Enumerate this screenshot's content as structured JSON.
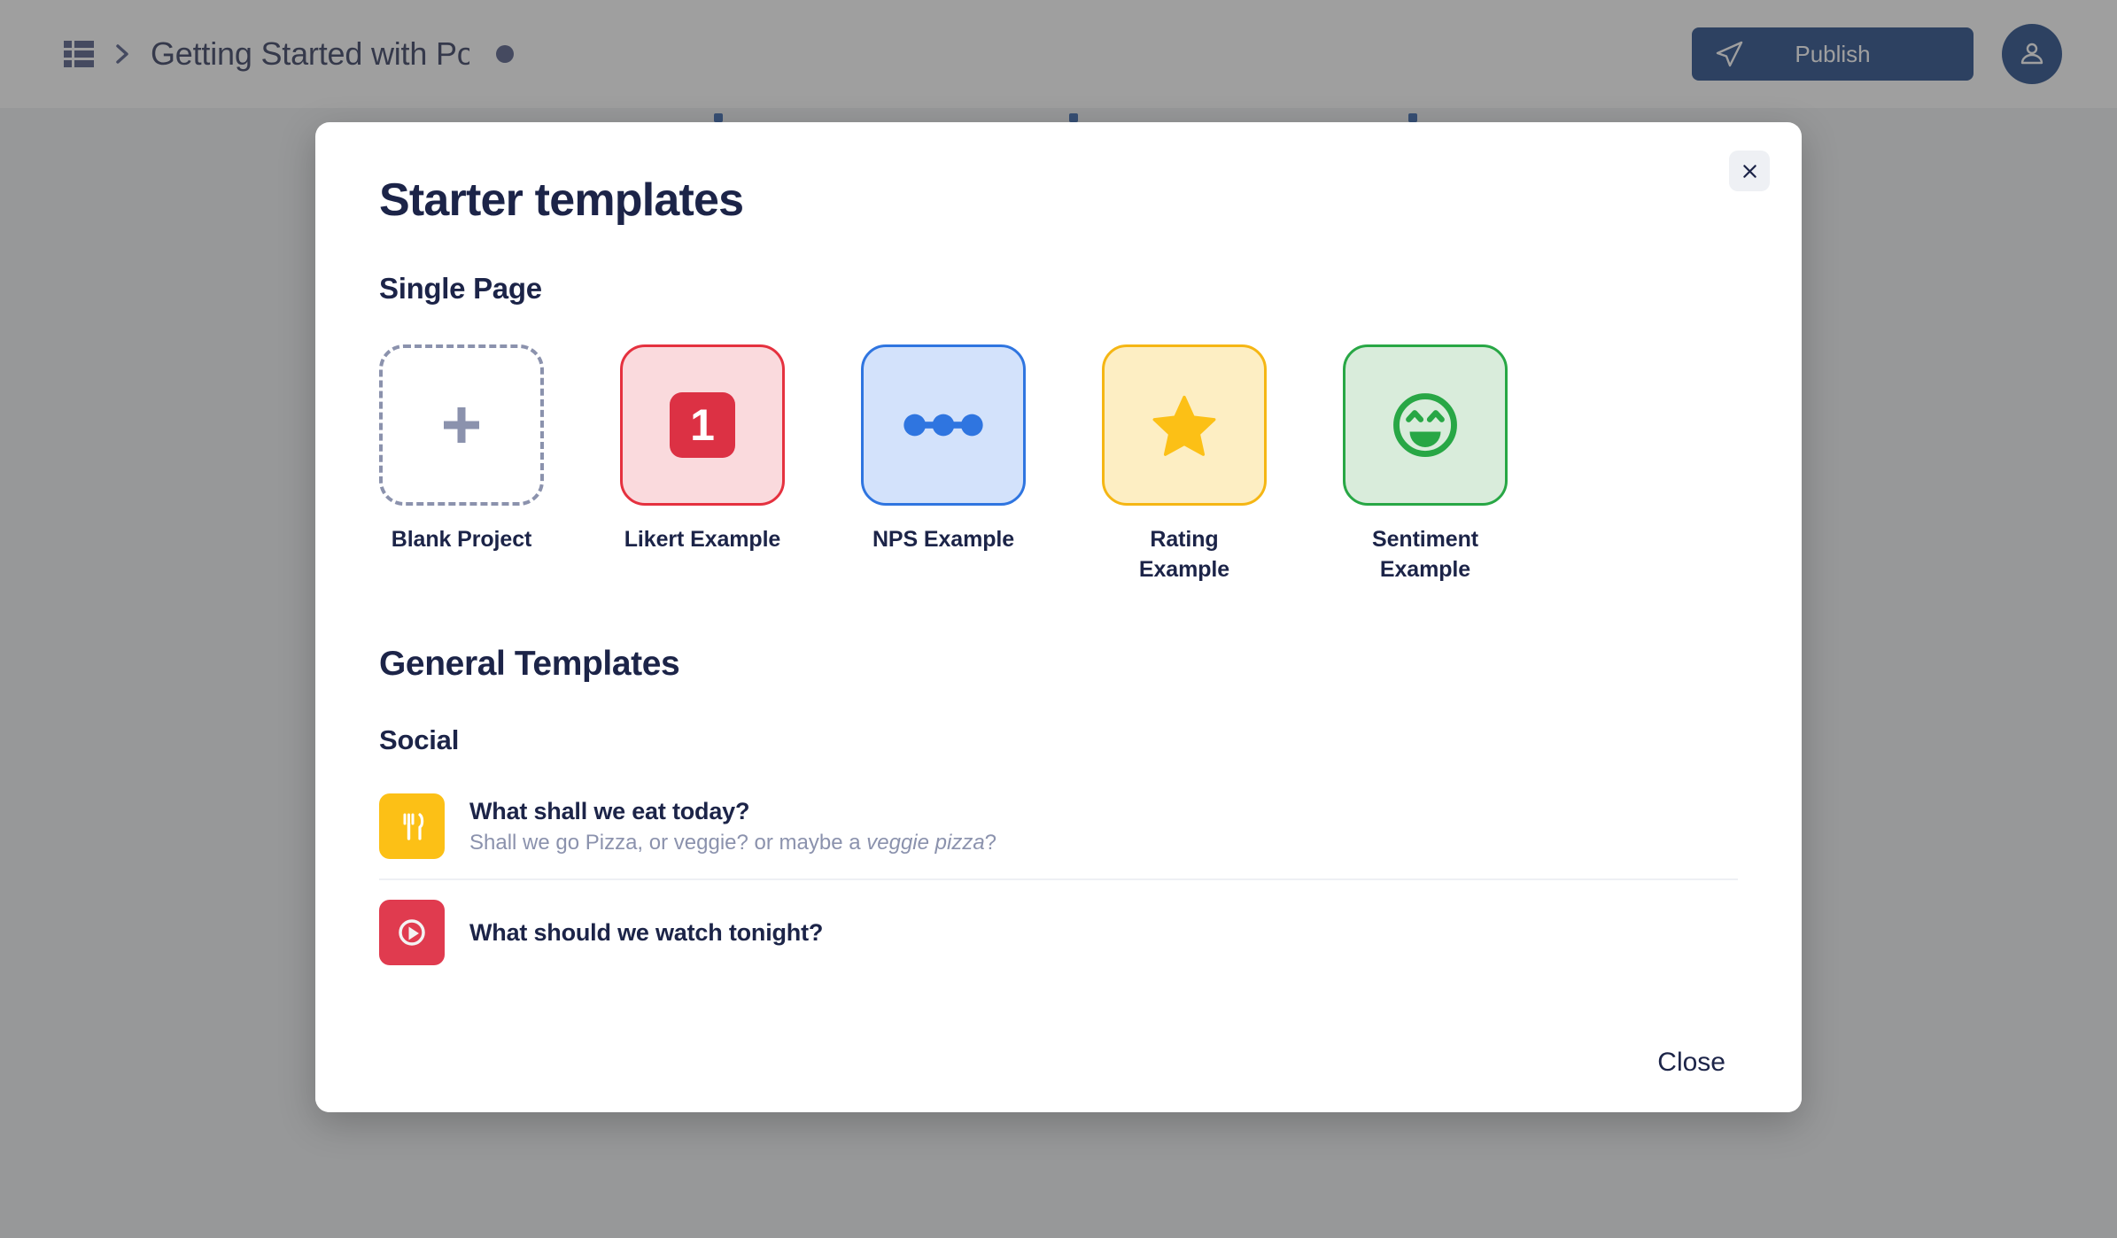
{
  "topbar": {
    "grid_icon": "grid-icon",
    "chevron_icon": "chevron-right-icon",
    "document_title": "Getting Started with Po",
    "unsaved_indicator": "unsaved-dot",
    "publish_label": "Publish",
    "publish_icon": "paper-plane-icon",
    "avatar_icon": "user-icon",
    "publish_color": "#1b4283"
  },
  "modal": {
    "title": "Starter templates",
    "close_icon": "close-icon",
    "footer_close_label": "Close",
    "sections": {
      "single_page_heading": "Single Page",
      "general_heading": "General Templates",
      "social_heading": "Social"
    }
  },
  "starter_cards": [
    {
      "label": "Blank Project",
      "icon": "plus-icon",
      "bg": "#ffffff",
      "border": "#8b92ad",
      "accent": "#8b92ad"
    },
    {
      "label": "Likert Example",
      "icon": "number-one-badge-icon",
      "bg": "#fadadd",
      "border": "#e5313f",
      "accent": "#dc3144",
      "badge_value": "1"
    },
    {
      "label": "NPS Example",
      "icon": "nps-slider-icon",
      "bg": "#d3e2fb",
      "border": "#2f75e0",
      "accent": "#2f75e0"
    },
    {
      "label": "Rating Example",
      "icon": "star-icon",
      "bg": "#fdeec3",
      "border": "#f5b614",
      "accent": "#fcc016"
    },
    {
      "label": "Sentiment Example",
      "icon": "smiley-face-icon",
      "bg": "#d9ecdb",
      "border": "#28a745",
      "accent": "#28a745"
    }
  ],
  "social_templates": [
    {
      "title": "What shall we eat today?",
      "subtitle_pre": "Shall we go Pizza, or veggie? or maybe a ",
      "subtitle_em": "veggie pizza",
      "subtitle_post": "?",
      "icon": "fork-knife-icon",
      "icon_bg": "#fcc016"
    },
    {
      "title": "What should we watch tonight?",
      "subtitle_pre": "",
      "subtitle_em": "",
      "subtitle_post": "",
      "icon": "play-circle-icon",
      "icon_bg": "#e03b4f"
    }
  ]
}
